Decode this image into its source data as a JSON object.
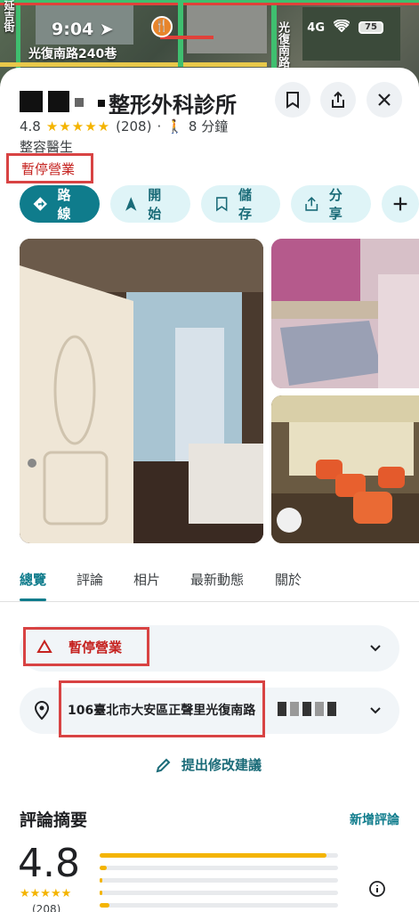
{
  "status_bar": {
    "time": "9:04",
    "signal": "4G",
    "battery": "75"
  },
  "map": {
    "road_label": "光復南路240巷",
    "road_vertical": "光復南路",
    "road_vertical_left": "延吉街"
  },
  "place": {
    "title_visible": "整形外科診所",
    "rating": "4.8",
    "stars": "★★★★★",
    "review_count": "(208)",
    "walk_time": "8 分鐘",
    "category": "整容醫生",
    "status": "暫停營業"
  },
  "actions": [
    {
      "label": "路線",
      "icon": "directions-icon"
    },
    {
      "label": "開始",
      "icon": "navigation-arrow-icon"
    },
    {
      "label": "儲存",
      "icon": "bookmark-icon"
    },
    {
      "label": "分享",
      "icon": "share-icon"
    }
  ],
  "tabs": [
    "總覽",
    "評論",
    "相片",
    "最新動態",
    "關於"
  ],
  "info": {
    "closed_label": "暫停營業",
    "address": "106臺北市大安區正聲里光復南路",
    "suggest_edit": "提出修改建議"
  },
  "reviews": {
    "title": "評論摘要",
    "new_review": "新增評論",
    "rating": "4.8",
    "stars": "★★★★★",
    "count": "(208)",
    "distribution": [
      0.95,
      0.03,
      0.01,
      0.01,
      0.04
    ]
  },
  "colors": {
    "accent": "#0f7c8c",
    "chip_bg": "#dff4f7",
    "closed_red": "#c5221f",
    "star": "#f4b400"
  }
}
